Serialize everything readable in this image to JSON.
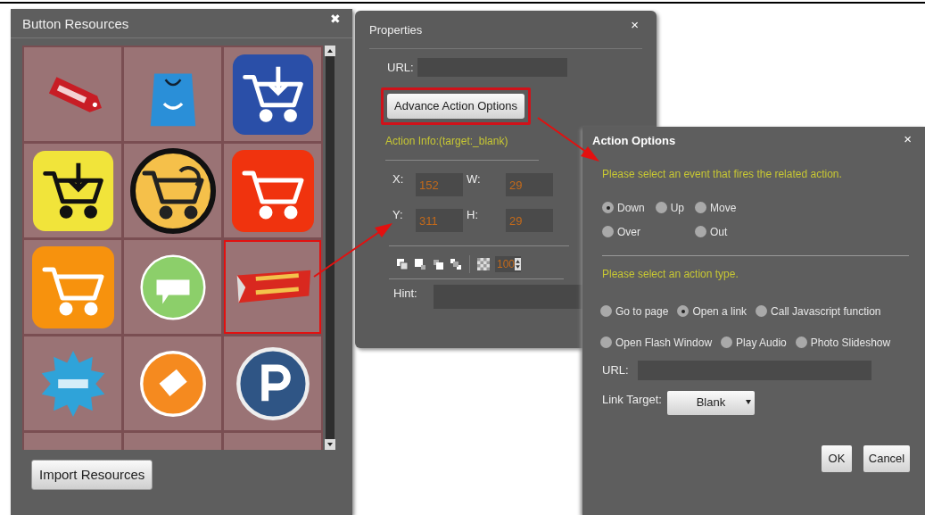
{
  "resources_window": {
    "title": "Button Resources",
    "close": "✖",
    "tiles": [
      {
        "kind": "tag",
        "selected": false
      },
      {
        "kind": "bag",
        "selected": false
      },
      {
        "kind": "cart-blue",
        "selected": false
      },
      {
        "kind": "cart-yellow",
        "selected": false
      },
      {
        "kind": "cart-circle",
        "selected": false
      },
      {
        "kind": "cart-red",
        "selected": false
      },
      {
        "kind": "cart-orange",
        "selected": false
      },
      {
        "kind": "sticker-green",
        "selected": false
      },
      {
        "kind": "banner-red",
        "selected": true
      },
      {
        "kind": "starburst",
        "selected": false
      },
      {
        "kind": "sticker-orange",
        "selected": false
      },
      {
        "kind": "sticker-blue",
        "selected": false
      }
    ],
    "import_button": "Import Resources"
  },
  "properties_window": {
    "title": "Properties",
    "close": "×",
    "url_label": "URL:",
    "advance_button": "Advance Action Options",
    "action_info": "Action Info:(target:_blank)",
    "fields": [
      {
        "label": "X:",
        "value": "152"
      },
      {
        "label": "W:",
        "value": "29"
      },
      {
        "label": "Y:",
        "value": "311"
      },
      {
        "label": "H:",
        "value": "29"
      }
    ],
    "opacity": "100",
    "hint_label": "Hint:"
  },
  "action_window": {
    "title": "Action Options",
    "close": "×",
    "event_prompt": "Please select an event that fires the related action.",
    "events": [
      {
        "label": "Down",
        "selected": true
      },
      {
        "label": "Up",
        "selected": false
      },
      {
        "label": "Move",
        "selected": false
      },
      {
        "label": "Over",
        "selected": false
      },
      {
        "label": "Out",
        "selected": false
      }
    ],
    "type_prompt": "Please select an action type.",
    "types": [
      {
        "label": "Go to page",
        "selected": false
      },
      {
        "label": "Open a link",
        "selected": true
      },
      {
        "label": "Call Javascript function",
        "selected": false
      },
      {
        "label": "Open Flash Window",
        "selected": false
      },
      {
        "label": "Play Audio",
        "selected": false
      },
      {
        "label": "Photo Slideshow",
        "selected": false
      }
    ],
    "url_label": "URL:",
    "target_label": "Link Target:",
    "target_value": "Blank",
    "ok": "OK",
    "cancel": "Cancel"
  }
}
